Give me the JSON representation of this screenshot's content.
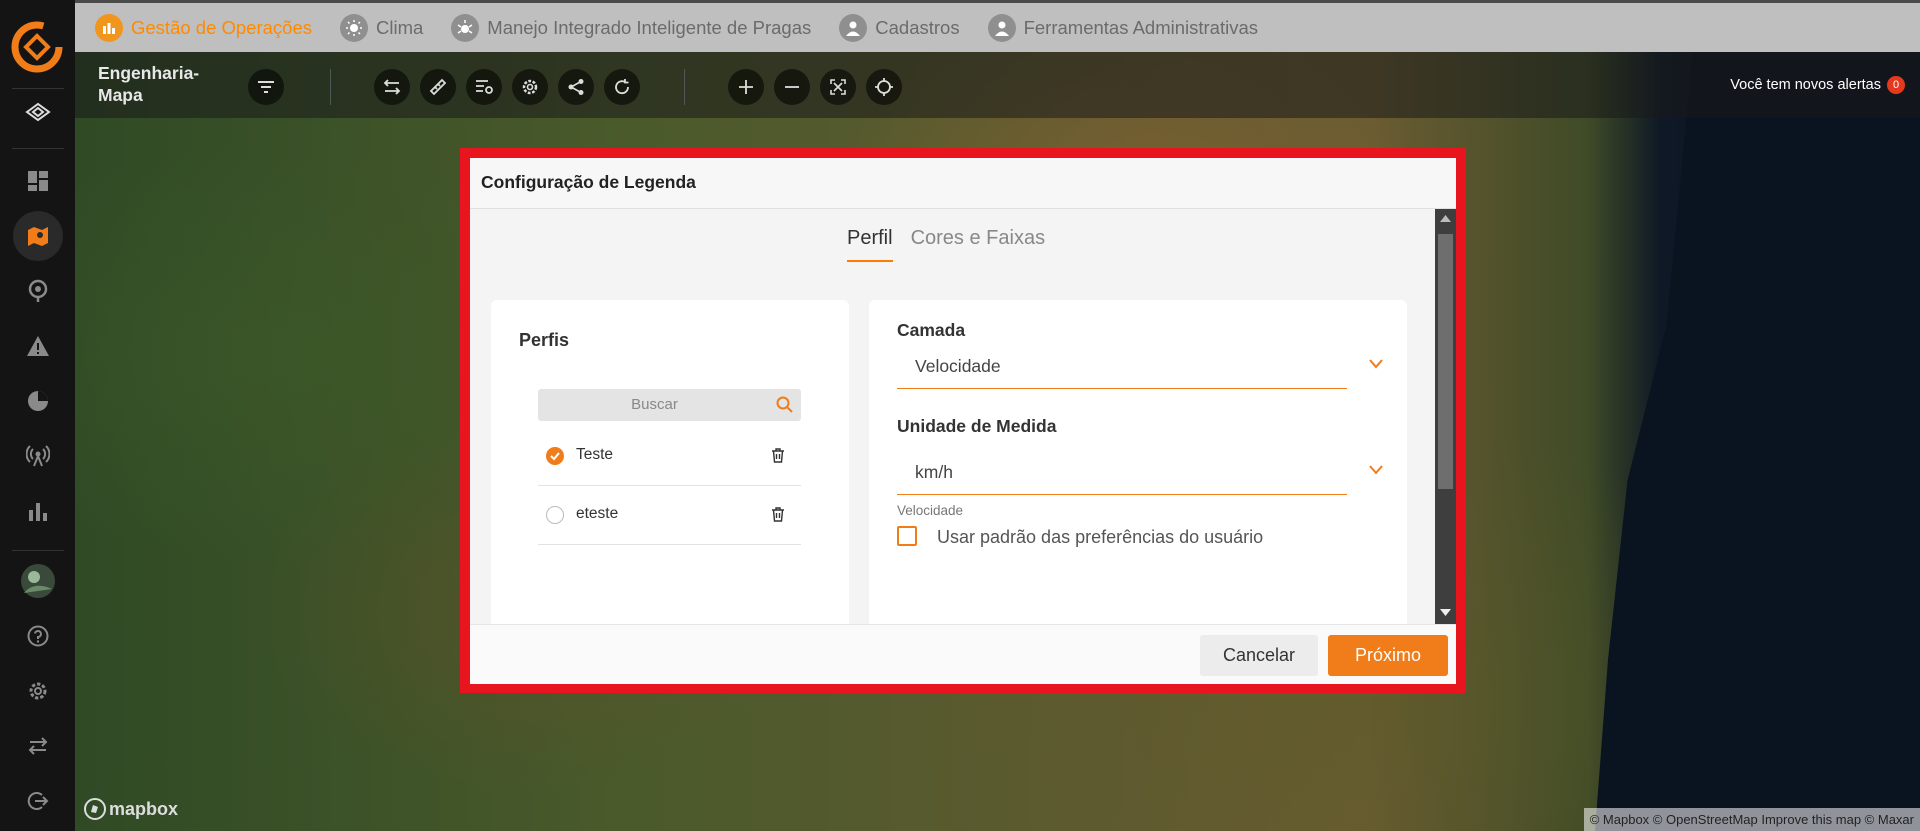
{
  "nav": {
    "tabs": [
      {
        "label": "Gestão de Operações",
        "icon": "operations-icon",
        "active": true
      },
      {
        "label": "Clima",
        "icon": "sun-icon"
      },
      {
        "label": "Manejo Integrado Inteligente de Pragas",
        "icon": "pest-icon"
      },
      {
        "label": "Cadastros",
        "icon": "user-icon"
      },
      {
        "label": "Ferramentas Administrativas",
        "icon": "admin-user-icon"
      }
    ]
  },
  "toolbar": {
    "page_title": "Engenharia-\nMapa",
    "alerts_text": "Você tem novos alertas",
    "alerts_count": "0"
  },
  "modal": {
    "title": "Configuração de Legenda",
    "tabs": [
      "Perfil",
      "Cores e Faixas"
    ],
    "profiles_title": "Perfis",
    "search_placeholder": "Buscar",
    "profiles": [
      {
        "name": "Teste",
        "selected": true
      },
      {
        "name": "eteste",
        "selected": false
      }
    ],
    "layer_label": "Camada",
    "layer_value": "Velocidade",
    "unit_label": "Unidade de Medida",
    "unit_value": "km/h",
    "unit_hint": "Velocidade",
    "default_pref_label": "Usar padrão das preferências do usuário",
    "cancel": "Cancelar",
    "next": "Próximo"
  },
  "map": {
    "logo_text": "mapbox",
    "attribution": "© Mapbox © OpenStreetMap Improve this map © Maxar"
  },
  "colors": {
    "accent": "#f07c1a",
    "highlight_border": "#e8141e"
  }
}
